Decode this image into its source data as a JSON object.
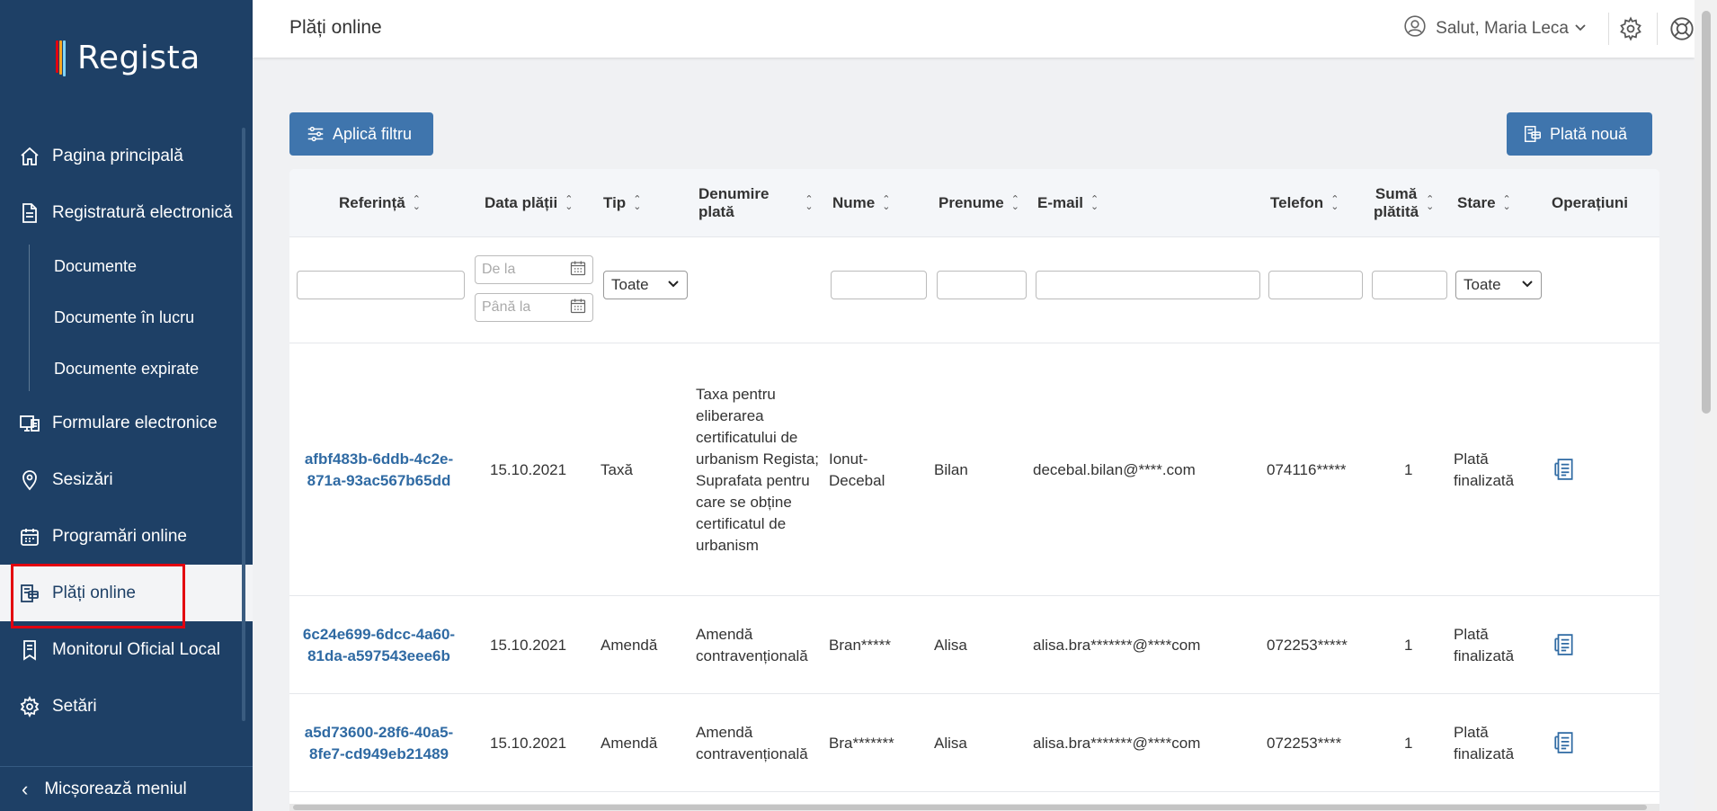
{
  "app": {
    "logo_text": "Regista"
  },
  "sidebar": {
    "items": [
      {
        "label": "Pagina principală",
        "icon": "home-icon"
      },
      {
        "label": "Registratură electronică",
        "icon": "document-icon"
      },
      {
        "label": "Formulare electronice",
        "icon": "monitor-form-icon"
      },
      {
        "label": "Sesizări",
        "icon": "location-pin-icon"
      },
      {
        "label": "Programări online",
        "icon": "calendar-icon"
      },
      {
        "label": "Plăți online",
        "icon": "payment-icon"
      },
      {
        "label": "Monitorul Oficial Local",
        "icon": "official-doc-icon"
      },
      {
        "label": "Setări",
        "icon": "gear-icon"
      }
    ],
    "sub_items": [
      "Documente",
      "Documente în lucru",
      "Documente expirate"
    ],
    "collapse_label": "Micșorează meniul"
  },
  "header": {
    "title": "Plăți online",
    "user_greeting": "Salut, Maria Leca"
  },
  "toolbar": {
    "filter_label": "Aplică filtru",
    "new_payment_label": "Plată nouă"
  },
  "table": {
    "columns": {
      "ref": "Referință",
      "date": "Data plății",
      "type": "Tip",
      "name_line1": "Denumire",
      "name_line2": "plată",
      "last": "Nume",
      "first": "Prenume",
      "email": "E-mail",
      "phone": "Telefon",
      "sum_line1": "Sumă",
      "sum_line2": "plătită",
      "status": "Stare",
      "ops": "Operațiuni"
    },
    "filters": {
      "date_from": "De la",
      "date_to": "Până la",
      "type_select": "Toate",
      "status_select": "Toate"
    },
    "rows": [
      {
        "ref": "afbf483b-6ddb-4c2e-871a-93ac567b65dd",
        "date": "15.10.2021",
        "type": "Taxă",
        "name": "Taxa pentru eliberarea certificatului de urbanism Regista; Suprafata pentru care se obține certificatul de urbanism",
        "last": "Ionut-Decebal",
        "first": "Bilan",
        "email": "decebal.bilan@****.com",
        "phone": "074116*****",
        "sum": "1",
        "status": "Plată finalizată"
      },
      {
        "ref": "6c24e699-6dcc-4a60-81da-a597543eee6b",
        "date": "15.10.2021",
        "type": "Amendă",
        "name": "Amendă contravențională",
        "last": "Bran*****",
        "first": "Alisa",
        "email": "alisa.bra*******@****com",
        "phone": "072253*****",
        "sum": "1",
        "status": "Plată finalizată"
      },
      {
        "ref": "a5d73600-28f6-40a5-8fe7-cd949eb21489",
        "date": "15.10.2021",
        "type": "Amendă",
        "name": "Amendă contravențională",
        "last": "Bra*******",
        "first": "Alisa",
        "email": "alisa.bra*******@****com",
        "phone": "072253****",
        "sum": "1",
        "status": "Plată finalizată"
      }
    ]
  }
}
